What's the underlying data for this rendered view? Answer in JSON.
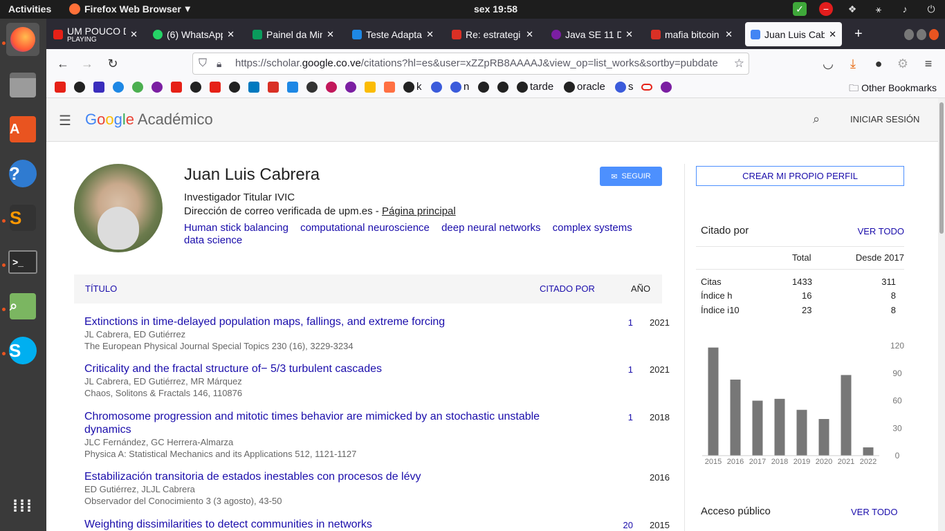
{
  "topbar": {
    "activities": "Activities",
    "app": "Firefox Web Browser",
    "clock": "sex 19:58"
  },
  "tabs": [
    {
      "title": "UM POUCO D",
      "sub": "PLAYING",
      "color": "#e62117"
    },
    {
      "title": "(6) WhatsApp",
      "color": "#25d366"
    },
    {
      "title": "Painel da Min",
      "color": "#0a9b5c"
    },
    {
      "title": "Teste Adapta",
      "color": "#1e88e5"
    },
    {
      "title": "Re: estrategi",
      "color": "#d93025"
    },
    {
      "title": "Java SE 11 De",
      "color": "#7b1fa2"
    },
    {
      "title": "mafia bitcoin",
      "color": "#d93025"
    },
    {
      "title": "Juan Luis Cab",
      "color": "#4285f4"
    }
  ],
  "url": {
    "prefix": "https://scholar.",
    "domain": "google.co.ve",
    "rest": "/citations?hl=es&user=xZZpRB8AAAAJ&view_op=list_works&sortby=pubdate"
  },
  "bookmarks": {
    "labels": [
      "k",
      "n",
      "tarde",
      "oracle",
      "s"
    ],
    "other": "Other Bookmarks"
  },
  "scholar": {
    "brand": "Académico",
    "login": "INICIAR SESIÓN"
  },
  "profile": {
    "name": "Juan Luis Cabrera",
    "role": "Investigador Titular IVIC",
    "email": "Dirección de correo verificada de upm.es - ",
    "homepage": "Página principal",
    "follow": "SEGUIR",
    "interests": [
      "Human stick balancing",
      "computational neuroscience",
      "deep neural networks",
      "complex systems",
      "data science"
    ]
  },
  "table": {
    "h_title": "TÍTULO",
    "h_cited": "CITADO POR",
    "h_year": "AÑO"
  },
  "articles": [
    {
      "title": "Extinctions in time-delayed population maps, fallings, and extreme forcing",
      "authors": "JL Cabrera, ED Gutiérrez",
      "venue": "The European Physical Journal Special Topics 230 (16), 3229-3234",
      "cited": "1",
      "year": "2021"
    },
    {
      "title": "Criticality and the fractal structure of− 5/3 turbulent cascades",
      "authors": "JL Cabrera, ED Gutiérrez, MR Márquez",
      "venue": "Chaos, Solitons & Fractals 146, 110876",
      "cited": "1",
      "year": "2021"
    },
    {
      "title": "Chromosome progression and mitotic times behavior are mimicked by an stochastic unstable dynamics",
      "authors": "JLC Fernández, GC Herrera-Almarza",
      "venue": "Physica A: Statistical Mechanics and its Applications 512, 1121-1127",
      "cited": "1",
      "year": "2018"
    },
    {
      "title": "Estabilización transitoria de estados inestables con procesos de lévy",
      "authors": "ED Gutiérrez, JLJL Cabrera",
      "venue": "Observador del Conocimiento 3 (3 agosto), 43-50",
      "cited": "",
      "year": "2016"
    },
    {
      "title": "Weighting dissimilarities to detect communities in networks",
      "authors": "",
      "venue": "",
      "cited": "20",
      "year": "2015"
    }
  ],
  "side": {
    "create": "CREAR MI PROPIO PERFIL",
    "cited_by": "Citado por",
    "view_all": "VER TODO",
    "col_total": "Total",
    "col_since": "Desde 2017",
    "rows": [
      {
        "label": "Citas",
        "total": "1433",
        "since": "311"
      },
      {
        "label": "Índice h",
        "total": "16",
        "since": "8"
      },
      {
        "label": "Índice i10",
        "total": "23",
        "since": "8"
      }
    ],
    "public_access": "Acceso público",
    "view_all2": "VER TODO"
  },
  "chart_data": {
    "type": "bar",
    "categories": [
      "2015",
      "2016",
      "2017",
      "2018",
      "2019",
      "2020",
      "2021",
      "2022"
    ],
    "values": [
      118,
      83,
      60,
      62,
      50,
      40,
      88,
      9
    ],
    "ylim": [
      0,
      120
    ],
    "yticks": [
      0,
      30,
      60,
      90,
      120
    ],
    "color": "#777777"
  }
}
